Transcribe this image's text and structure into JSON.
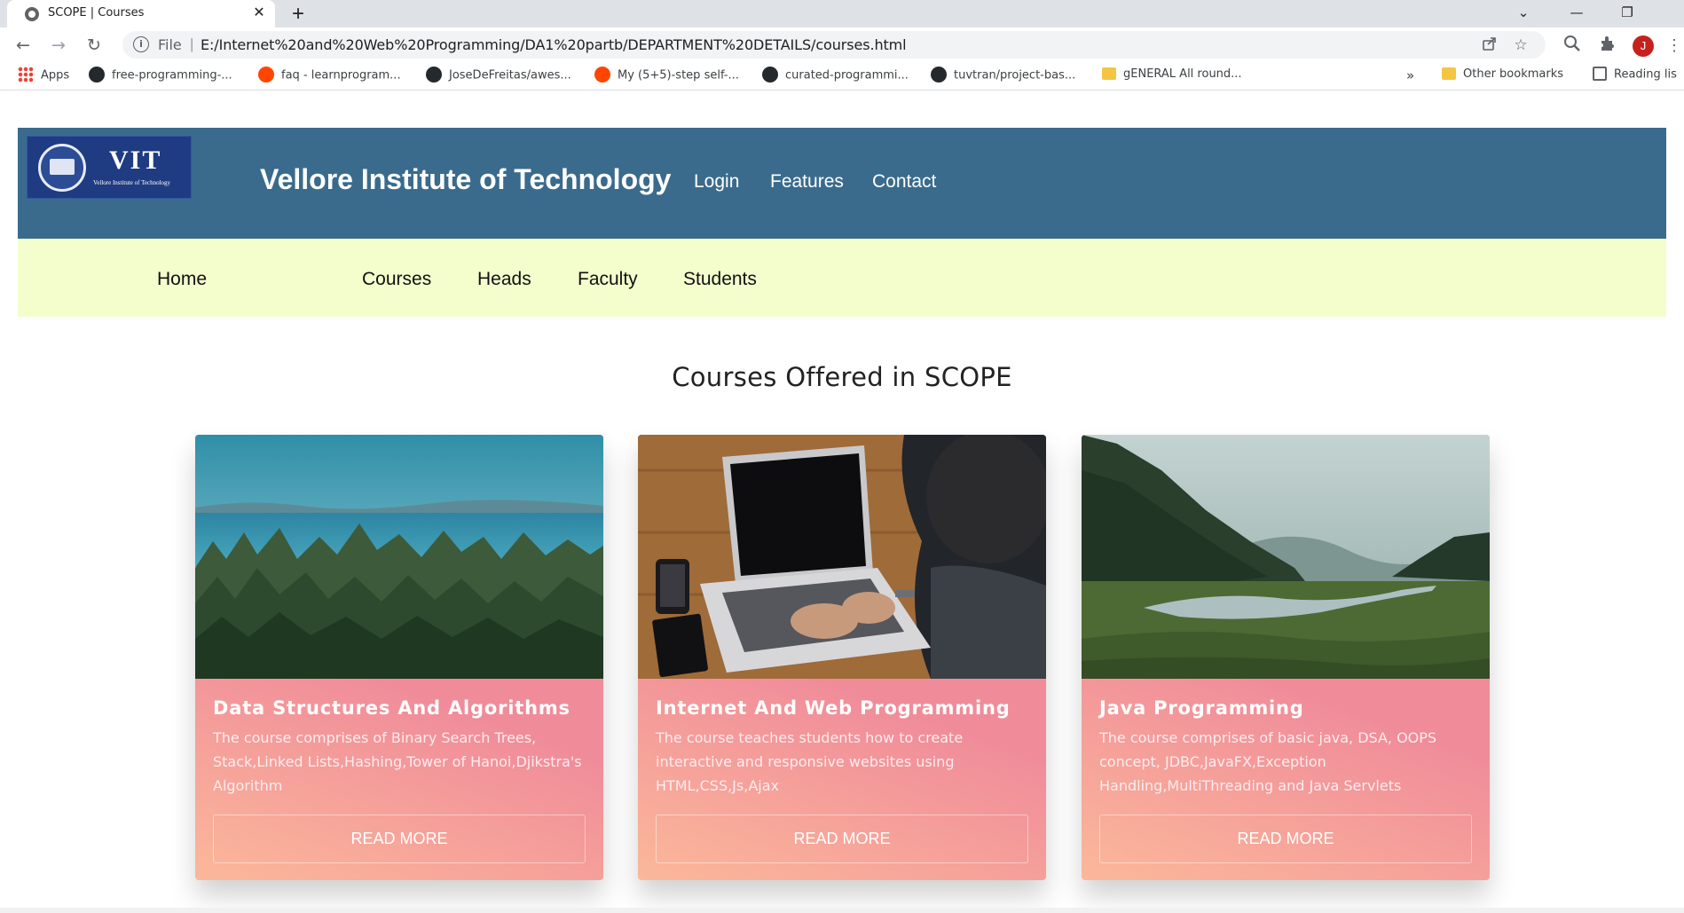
{
  "browser": {
    "tab_title": "SCOPE | Courses",
    "tab_close": "✕",
    "new_tab": "+",
    "window": {
      "minimize": "—",
      "restore": "❐",
      "tabsearch": "⌄"
    },
    "nav": {
      "back": "←",
      "forward": "→",
      "reload": "↻"
    },
    "address": {
      "info_glyph": "i",
      "scheme": "File",
      "separator": "|",
      "url": "E:/Internet%20and%20Web%20Programming/DA1%20partb/DEPARTMENT%20DETAILS/courses.html"
    },
    "profile_initial": "J",
    "bookmarks": [
      {
        "label": "Apps",
        "icon": "apps-grid-icon"
      },
      {
        "label": "free-programming-...",
        "icon": "github-icon"
      },
      {
        "label": "faq - learnprogram...",
        "icon": "reddit-icon"
      },
      {
        "label": "JoseDeFreitas/awes...",
        "icon": "github-icon"
      },
      {
        "label": "My (5+5)-step self-...",
        "icon": "reddit-icon"
      },
      {
        "label": "curated-programmi...",
        "icon": "github-icon"
      },
      {
        "label": "tuvtran/project-bas...",
        "icon": "github-icon"
      },
      {
        "label": "gENERAL All round...",
        "icon": "folder-icon"
      }
    ],
    "bookmarks_overflow": "»",
    "other_bookmarks": "Other bookmarks",
    "reading_list": "Reading lis"
  },
  "site": {
    "logo": {
      "text": "VIT",
      "subtitle": "Vellore Institute of Technology"
    },
    "title": "Vellore Institute of Technology",
    "top_links": [
      "Login",
      "Features",
      "Contact"
    ],
    "subnav": [
      "Home",
      "Courses",
      "Heads",
      "Faculty",
      "Students"
    ],
    "colors": {
      "header": "#3a6b8d",
      "subnav": "#f4fdcc",
      "card_start": "#fbb89a",
      "card_end": "#ee8b9c"
    }
  },
  "main": {
    "heading": "Courses Offered in SCOPE",
    "cards": [
      {
        "title": "Data Structures And Algorithms",
        "description": "The course comprises of Binary Search Trees, Stack,Linked Lists,Hashing,Tower of Hanoi,Djikstra's Algorithm",
        "button": "READ MORE",
        "image": "forest-lake-photo"
      },
      {
        "title": "Internet And Web Programming",
        "description": "The course teaches students how to create interactive and responsive websites using HTML,CSS,Js,Ajax",
        "button": "READ MORE",
        "image": "laptop-typing-photo"
      },
      {
        "title": "Java Programming",
        "description": "The course comprises of basic java, DSA, OOPS concept, JDBC,JavaFX,Exception Handling,MultiThreading and Java Servlets",
        "button": "READ MORE",
        "image": "valley-river-photo"
      }
    ]
  }
}
